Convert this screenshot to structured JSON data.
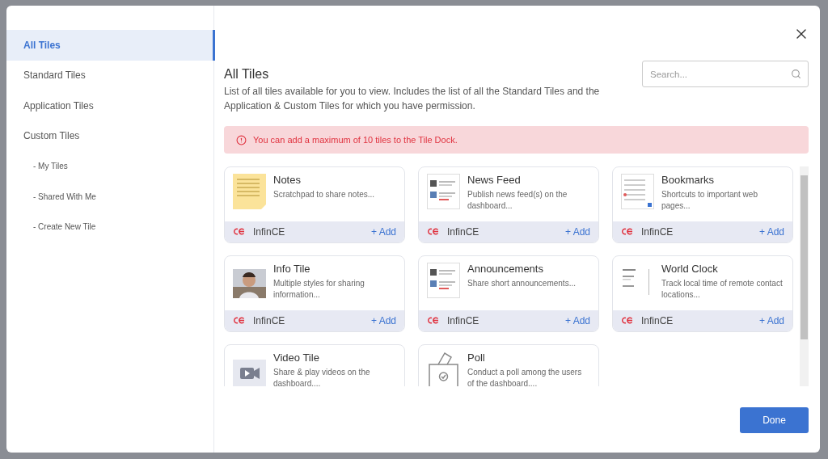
{
  "sidebar": {
    "items": [
      {
        "label": "All Tiles",
        "selected": true,
        "sub": false
      },
      {
        "label": "Standard Tiles",
        "selected": false,
        "sub": false
      },
      {
        "label": "Application Tiles",
        "selected": false,
        "sub": false
      },
      {
        "label": "Custom Tiles",
        "selected": false,
        "sub": false
      },
      {
        "label": "- My Tiles",
        "selected": false,
        "sub": true
      },
      {
        "label": "- Shared With Me",
        "selected": false,
        "sub": true
      },
      {
        "label": "- Create New Tile",
        "selected": false,
        "sub": true
      }
    ]
  },
  "header": {
    "title": "All Tiles",
    "description": "List of all tiles available for you to view. Includes the list of all the Standard Tiles and the Application & Custom Tiles for which you have permission.",
    "search": {
      "placeholder": "Search..."
    }
  },
  "alert": {
    "text": "You can add a maximum of 10 tiles to the Tile Dock."
  },
  "tiles": [
    {
      "kind": "notes",
      "title": "Notes",
      "description": "Scratchpad to share notes...",
      "source": "InfinCE",
      "action": "+ Add"
    },
    {
      "kind": "feed",
      "title": "News Feed",
      "description": "Publish news feed(s) on the dashboard...",
      "source": "InfinCE",
      "action": "+ Add"
    },
    {
      "kind": "list",
      "title": "Bookmarks",
      "description": "Shortcuts to important web pages...",
      "source": "InfinCE",
      "action": "+ Add"
    },
    {
      "kind": "picture",
      "title": "Info Tile",
      "description": "Multiple styles for sharing information...",
      "source": "InfinCE",
      "action": "+ Add"
    },
    {
      "kind": "feed",
      "title": "Announcements",
      "description": "Share short announcements...",
      "source": "InfinCE",
      "action": "+ Add"
    },
    {
      "kind": "clock",
      "title": "World Clock",
      "description": "Track local time of remote contact locations...",
      "source": "InfinCE",
      "action": "+ Add"
    },
    {
      "kind": "video",
      "title": "Video Tile",
      "description": "Share & play videos on the dashboard...."
    },
    {
      "kind": "poll",
      "title": "Poll",
      "description": "Conduct a poll among the users of the dashboard...."
    }
  ],
  "footer": {
    "button": "Done"
  }
}
